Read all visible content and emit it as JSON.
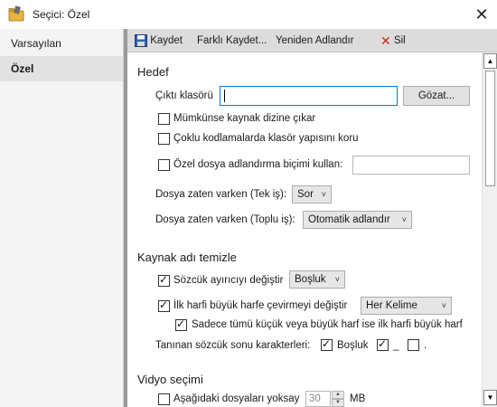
{
  "window": {
    "title": "Seçici: Özel",
    "close_glyph": "✕"
  },
  "sidebar": {
    "items": [
      {
        "label": "Varsayılan"
      },
      {
        "label": "Özel"
      }
    ]
  },
  "toolbar": {
    "save": "Kaydet",
    "save_as": "Farklı Kaydet...",
    "rename": "Yeniden Adlandır",
    "delete": "Sil"
  },
  "hedef": {
    "title": "Hedef",
    "output_folder_label": "Çıktı klasörü",
    "output_folder_value": "",
    "browse": "Gözat...",
    "extract_source_dir": {
      "label": "Mümkünse kaynak dizine çıkar",
      "checked": false
    },
    "keep_folder_structure": {
      "label": "Çoklu kodlamalarda klasör yapısını koru",
      "checked": false
    },
    "custom_naming": {
      "label": "Özel dosya adlandırma biçimi kullan:",
      "checked": false,
      "value": ""
    },
    "file_exists_single_label": "Dosya zaten varken (Tek iş):",
    "file_exists_single_value": "Sor",
    "file_exists_batch_label": "Dosya zaten varken (Toplu iş):",
    "file_exists_batch_value": "Otomatik adlandır"
  },
  "source_clean": {
    "title": "Kaynak adı temizle",
    "word_separator": {
      "label": "Sözcük ayırıcıyı değiştir",
      "checked": true,
      "value": "Boşluk"
    },
    "capitalize": {
      "label": "İlk harfi büyük harfe çevirmeyi değiştir",
      "checked": true,
      "value": "Her Kelime"
    },
    "only_uniform_case": {
      "label": "Sadece tümü küçük veya büyük harf ise ilk harfi büyük harf",
      "checked": true
    },
    "word_end_label": "Tanınan sözcük sonu karakterleri:",
    "word_end_space": {
      "label": "Boşluk",
      "checked": true
    },
    "word_end_underscore": {
      "label": "_",
      "checked": true
    },
    "word_end_dot": {
      "label": ".",
      "checked": false
    }
  },
  "video": {
    "title": "Vidyo seçimi",
    "ignore_below": {
      "label": "Aşağıdaki dosyaları yoksay",
      "checked": false,
      "value": "30",
      "unit": "MB"
    }
  },
  "colors": {
    "accent": "#0078d7",
    "delete_red": "#d11f1f",
    "sidebar_bg": "#f4f4f4",
    "toolbar_bg": "#dcdcdc"
  }
}
